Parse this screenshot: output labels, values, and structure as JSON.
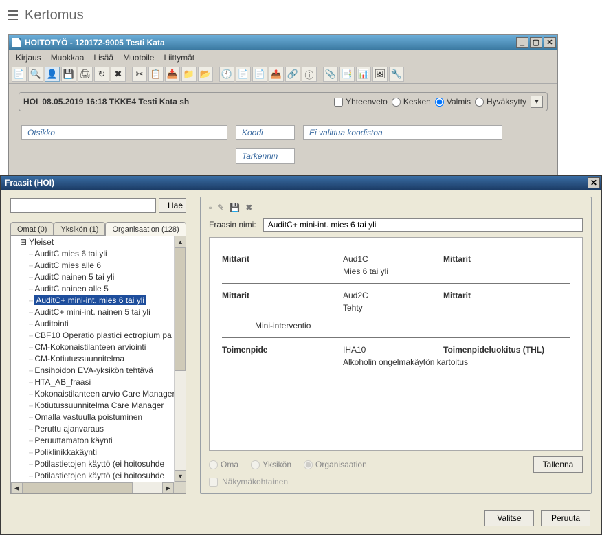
{
  "app": {
    "title": "Kertomus"
  },
  "mdi": {
    "title": "HOITOTYÖ - 120172-9005 Testi Kata",
    "menus": [
      "Kirjaus",
      "Muokkaa",
      "Lisää",
      "Muotoile",
      "Liittymät"
    ],
    "entry": {
      "code": "HOI",
      "stamp": "08.05.2019 16:18 TKKE4 Testi Kata sh",
      "summary_label": "Yhteenveto",
      "status": {
        "kesken": "Kesken",
        "valmis": "Valmis",
        "hyv": "Hyväksytty"
      }
    },
    "fields": {
      "otsikko": "Otsikko",
      "koodi": "Koodi",
      "koodistoa": "Ei valittua koodistoa",
      "tarkennin": "Tarkennin"
    }
  },
  "dlg": {
    "title": "Fraasit (HOI)",
    "search_btn": "Hae",
    "tabs": [
      {
        "label": "Omat (0)"
      },
      {
        "label": "Yksikön (1)"
      },
      {
        "label": "Organisaation (128)",
        "active": true
      }
    ],
    "tree_root": "Yleiset",
    "tree": [
      "AuditC mies 6 tai yli",
      "AuditC mies alle 6",
      "AuditC nainen 5 tai yli",
      "AuditC nainen alle 5",
      "AuditC+ mini-int. mies 6 tai yli",
      "AuditC+ mini-int. nainen 5 tai yli",
      "Auditointi",
      "CBF10 Operatio plastici ectropium pa",
      "CM-Kokonaistilanteen arviointi",
      "CM-Kotiutussuunnitelma",
      "Ensihoidon EVA-yksikön tehtävä",
      "HTA_AB_fraasi",
      "Kokonaistilanteen arvio Care Manager",
      "Kotiutussuunnitelma Care Manager",
      "Omalla vastuulla poistuminen",
      "Peruttu ajanvaraus",
      "Peruuttamaton käynti",
      "Poliklinikkakäynti",
      "Potilastietojen käyttö (ei hoitosuhde",
      "Potilastietojen käyttö (ei hoitosuhde"
    ],
    "tree_selected_index": 4,
    "panel": {
      "name_label": "Fraasin nimi:",
      "name_value": "AuditC+ mini-int. mies 6 tai yli",
      "rows": [
        {
          "c1": "Mittarit",
          "c2": "Aud1C",
          "c3": "Mittarit",
          "sub": "Mies 6 tai yli"
        },
        {
          "c1": "Mittarit",
          "c2": "Aud2C",
          "c3": "Mittarit",
          "sub": "Tehty",
          "sub2": "Mini-interventio"
        },
        {
          "c1": "Toimenpide",
          "c2": "IHA10",
          "c3": "Toimenpideluokitus (THL)",
          "sub": "Alkoholin ongelmakäytön kartoitus"
        }
      ],
      "scope": {
        "oma": "Oma",
        "yks": "Yksikön",
        "org": "Organisaation"
      },
      "view_specific": "Näkymäkohtainen",
      "save": "Tallenna"
    },
    "footer": {
      "choose": "Valitse",
      "cancel": "Peruuta"
    }
  }
}
